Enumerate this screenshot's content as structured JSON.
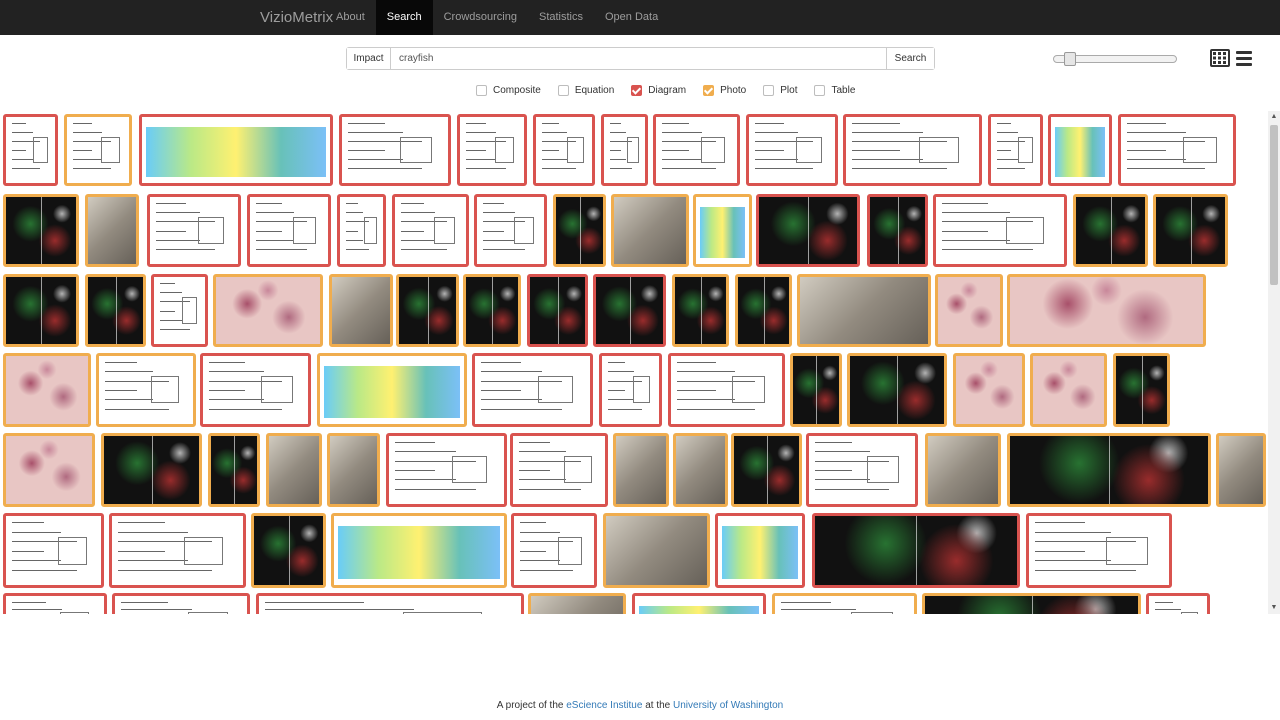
{
  "navbar": {
    "brand": "VizioMetrix",
    "items": [
      {
        "label": "About",
        "active": false
      },
      {
        "label": "Search",
        "active": true
      },
      {
        "label": "Crowdsourcing",
        "active": false
      },
      {
        "label": "Statistics",
        "active": false
      },
      {
        "label": "Open Data",
        "active": false
      }
    ]
  },
  "search": {
    "sort_label": "Impact",
    "query": "crayfish",
    "button_label": "Search"
  },
  "zoom_slider": {
    "value": 0.1
  },
  "view_icons": [
    "grid-view-icon",
    "list-view-icon"
  ],
  "filters": [
    {
      "label": "Composite",
      "checked": false
    },
    {
      "label": "Equation",
      "checked": false
    },
    {
      "label": "Diagram",
      "checked": true
    },
    {
      "label": "Photo",
      "checked": true
    },
    {
      "label": "Plot",
      "checked": false
    },
    {
      "label": "Table",
      "checked": false
    }
  ],
  "colors": {
    "navbar": "#222222",
    "diagram_border": "#d9534f",
    "photo_border": "#f0ad4e",
    "checkbox_diagram": "#d9534f",
    "checkbox_photo": "#f0ad4e",
    "link": "#337ab7"
  },
  "footer": {
    "prefix": "A project of the",
    "link1": "eScience Institue",
    "middle": "at the",
    "link2": "University of Washington"
  }
}
